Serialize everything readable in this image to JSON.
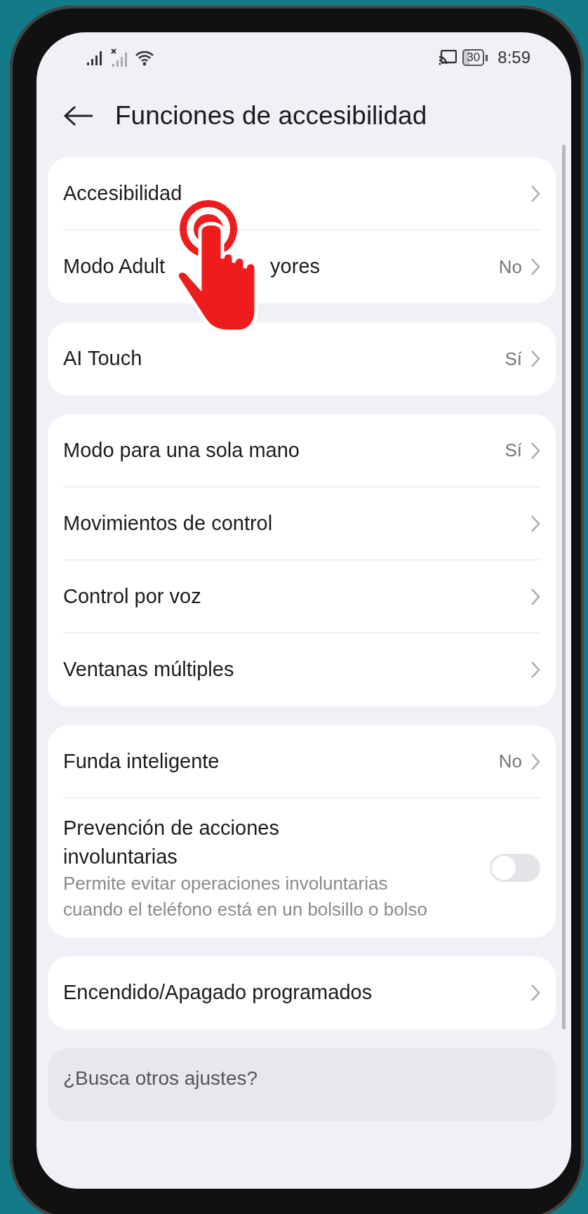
{
  "status_bar": {
    "battery": "30",
    "time": "8:59"
  },
  "header": {
    "title": "Funciones de accesibilidad"
  },
  "groups": [
    {
      "items": [
        {
          "kind": "link",
          "label": "Accesibilidad"
        },
        {
          "kind": "link",
          "label": "Modo Adult",
          "label_after_pointer": "yores",
          "value": "No"
        }
      ]
    },
    {
      "items": [
        {
          "kind": "link",
          "label": "AI Touch",
          "value": "Sí"
        }
      ]
    },
    {
      "items": [
        {
          "kind": "link",
          "label": "Modo para una sola mano",
          "value": "Sí"
        },
        {
          "kind": "link",
          "label": "Movimientos de control"
        },
        {
          "kind": "link",
          "label": "Control por voz"
        },
        {
          "kind": "link",
          "label": "Ventanas múltiples"
        }
      ]
    },
    {
      "items": [
        {
          "kind": "link",
          "label": "Funda inteligente",
          "value": "No"
        },
        {
          "kind": "switch",
          "label": "Prevención de acciones involuntarias",
          "description": "Permite evitar operaciones involuntarias cuando el teléfono está en un bolsillo o bolso",
          "on": false
        }
      ]
    },
    {
      "items": [
        {
          "kind": "link",
          "label": "Encendido/Apagado programados"
        }
      ]
    }
  ],
  "footer_card": {
    "title": "¿Busca otros ajustes?"
  }
}
